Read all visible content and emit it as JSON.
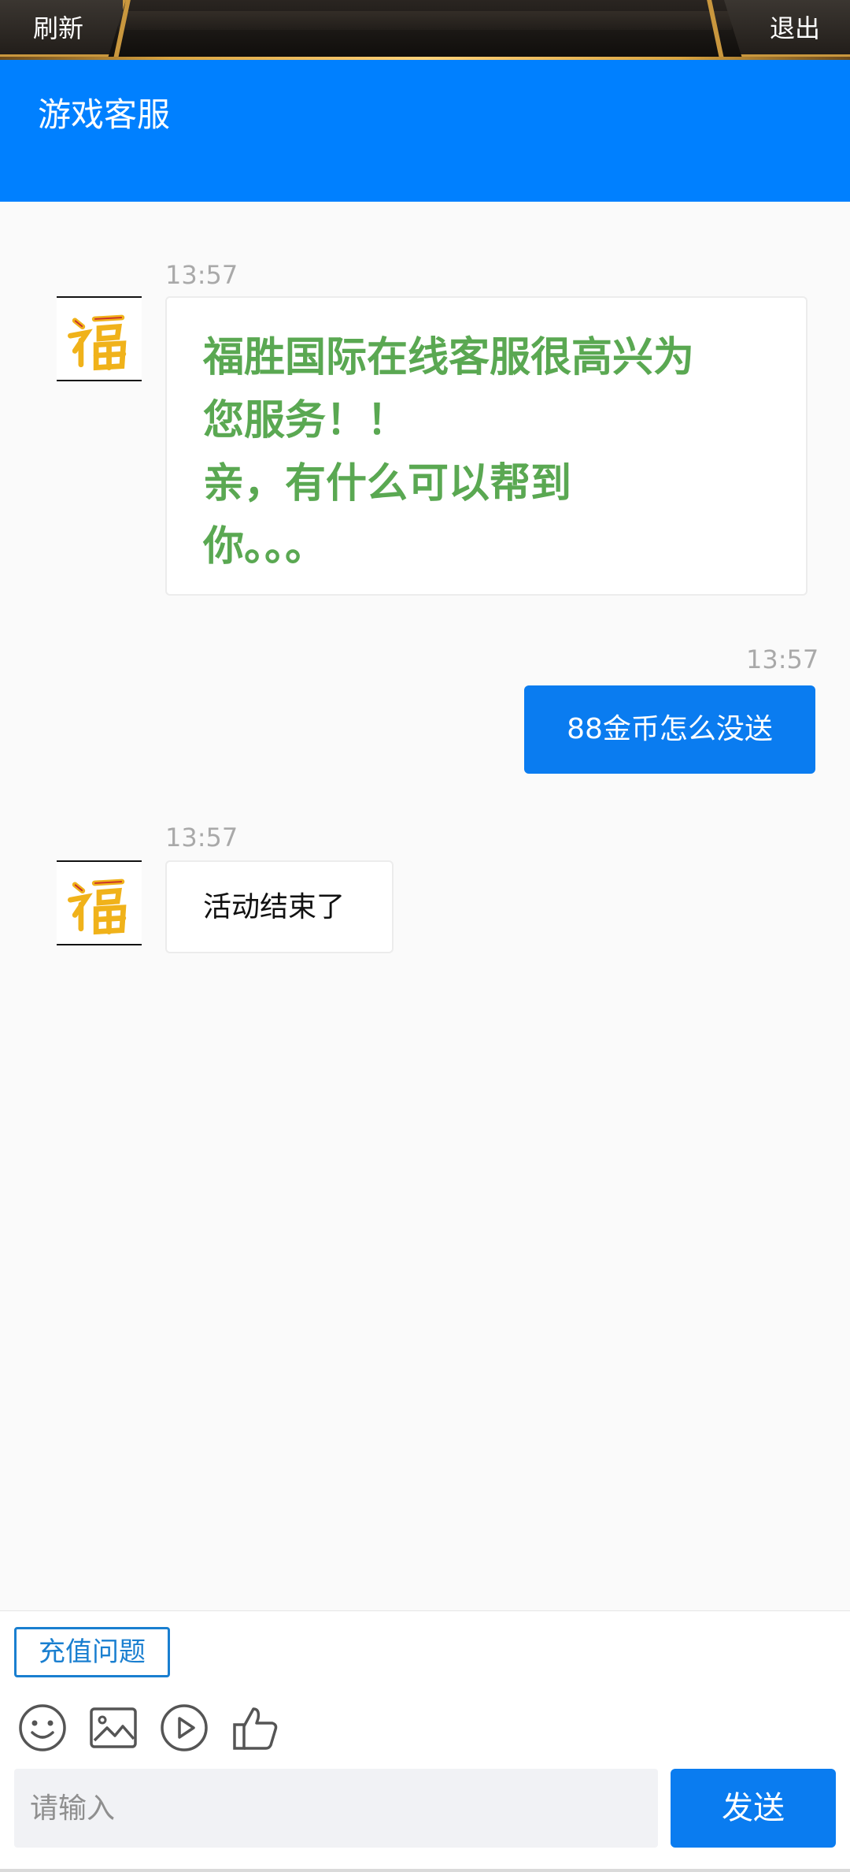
{
  "topbar": {
    "refresh_label": "刷新",
    "exit_label": "退出"
  },
  "header": {
    "title": "游戏客服"
  },
  "messages": [
    {
      "time": "13:57",
      "from": "agent",
      "text": "福胜国际在线客服很高兴为\n您服务！！\n亲，有什么可以帮到\n你。。。"
    },
    {
      "time": "13:57",
      "from": "user",
      "text": "88金币怎么没送"
    },
    {
      "time": "13:57",
      "from": "agent",
      "text": "活动结束了"
    }
  ],
  "quick_reply": {
    "label": "充值问题"
  },
  "input": {
    "placeholder": "请输入"
  },
  "send": {
    "label": "发送"
  },
  "colors": {
    "brand_blue": "#0080ff",
    "greeting_green": "#5aa852",
    "gold": "#c9973e"
  },
  "icons": [
    "emoji-icon",
    "image-icon",
    "video-icon",
    "thumbs-up-icon",
    "fu-avatar-icon"
  ]
}
